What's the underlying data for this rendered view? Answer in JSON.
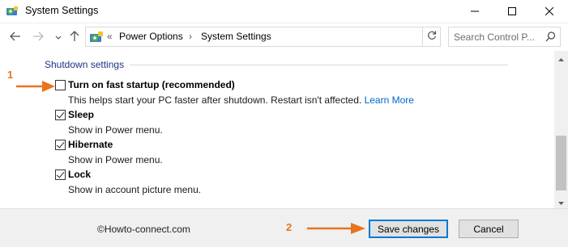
{
  "window": {
    "title": "System Settings",
    "icons": {
      "app": "control-panel-icon",
      "minimize": "minimize-icon",
      "maximize": "maximize-icon",
      "close": "close-icon"
    }
  },
  "address_bar": {
    "overflow": "«",
    "breadcrumbs": [
      "Power Options",
      "System Settings"
    ],
    "separator": "›",
    "search_placeholder": "Search Control P..."
  },
  "section": {
    "title": "Shutdown settings"
  },
  "options": [
    {
      "label": "Turn on fast startup (recommended)",
      "description": "This helps start your PC faster after shutdown. Restart isn't affected.",
      "link": "Learn More",
      "checked": false
    },
    {
      "label": "Sleep",
      "description": "Show in Power menu.",
      "checked": true
    },
    {
      "label": "Hibernate",
      "description": "Show in Power menu.",
      "checked": true
    },
    {
      "label": "Lock",
      "description": "Show in account picture menu.",
      "checked": true
    }
  ],
  "footer": {
    "watermark": "©Howto-connect.com",
    "save_label": "Save changes",
    "cancel_label": "Cancel"
  },
  "annotations": {
    "one": "1",
    "two": "2",
    "color": "#e8741e"
  },
  "colors": {
    "section_title": "#1e3287",
    "link": "#0066cc",
    "default_button_border": "#0078d7"
  }
}
